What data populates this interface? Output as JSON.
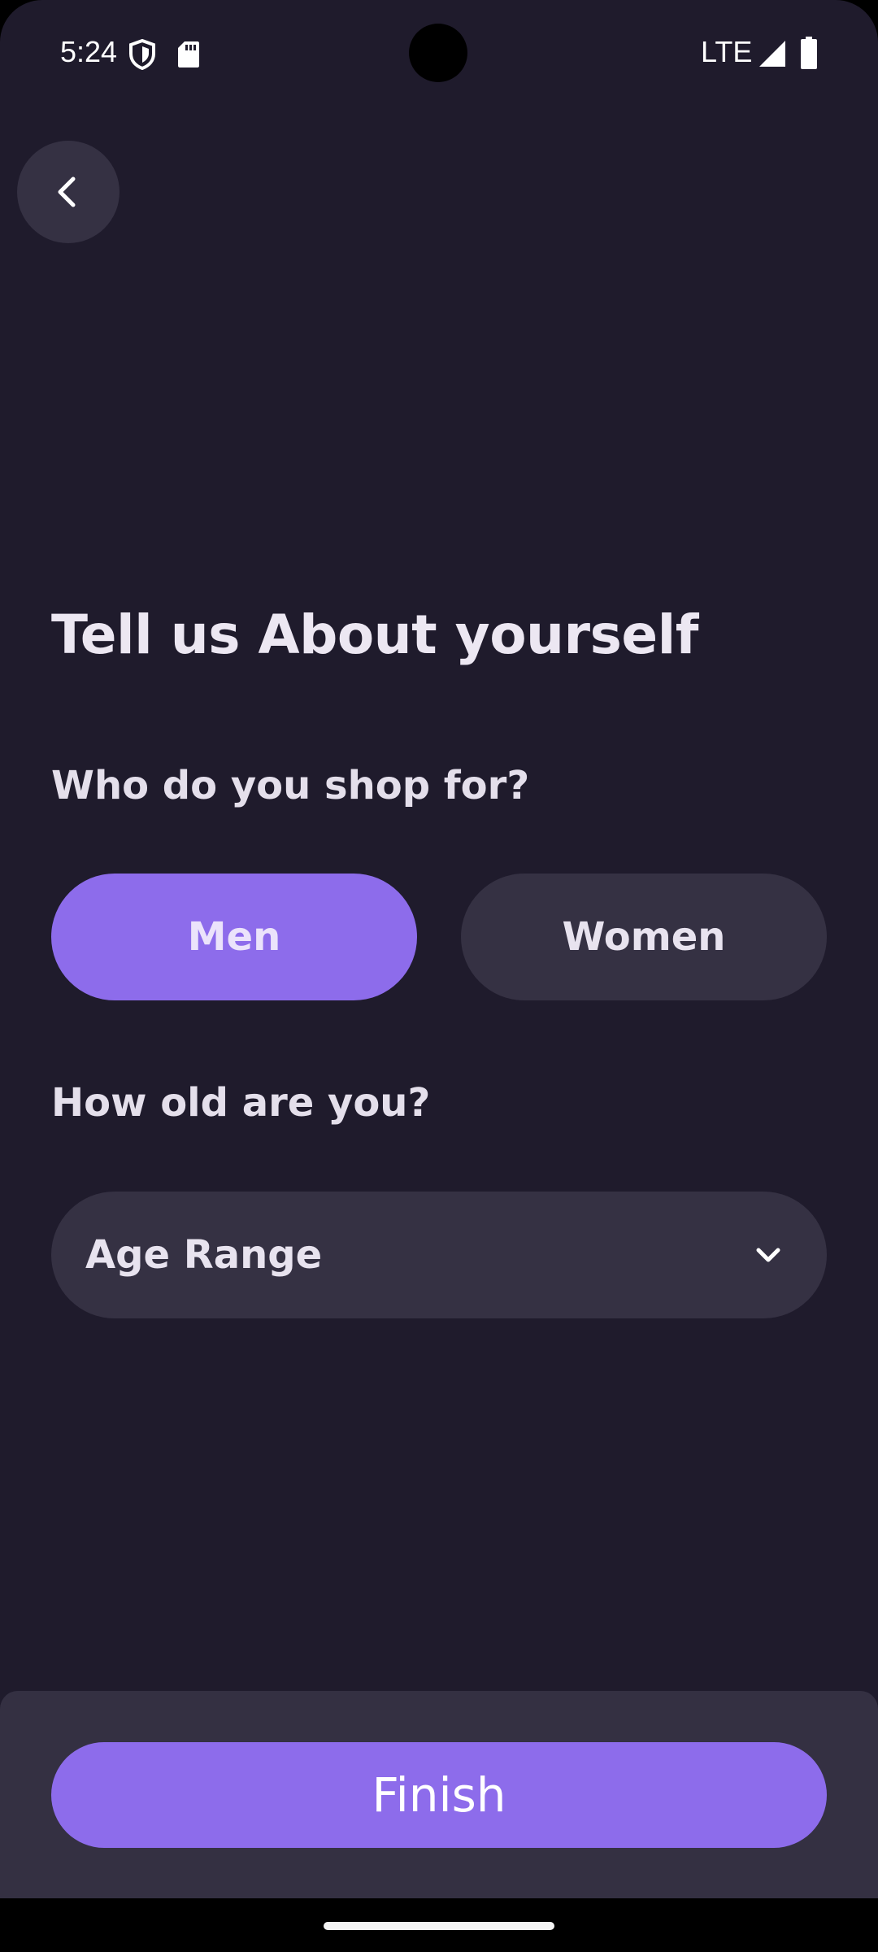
{
  "status_bar": {
    "time": "5:24",
    "network": "LTE",
    "icons": [
      "shield-icon",
      "sd-card-icon",
      "signal-icon",
      "battery-icon"
    ]
  },
  "header": {
    "back_icon": "chevron-left-icon"
  },
  "main": {
    "title": "Tell us About yourself",
    "shop_question": "Who do you shop for?",
    "options": [
      {
        "label": "Men",
        "selected": true
      },
      {
        "label": "Women",
        "selected": false
      }
    ],
    "age_question": "How old are you?",
    "age_select": {
      "value": "Age Range",
      "icon": "chevron-down-icon"
    }
  },
  "footer": {
    "finish_label": "Finish"
  },
  "colors": {
    "background": "#1f1b2c",
    "surface": "#353143",
    "accent": "#8d6ceb",
    "text": "#ece7f2"
  }
}
